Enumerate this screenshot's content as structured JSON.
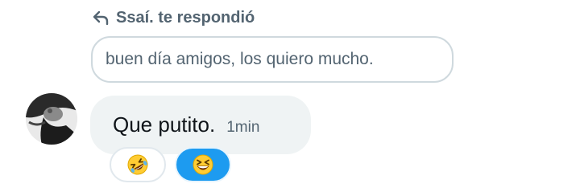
{
  "reply_header": {
    "icon": "reply-arrow-icon",
    "label": "Ssaí. te respondió"
  },
  "quoted_message": {
    "text": "buen día amigos, los quiero mucho."
  },
  "message": {
    "avatar": "user-avatar",
    "text": "Que putito.",
    "time": "1min"
  },
  "reactions": [
    {
      "emoji": "rolling-on-floor-laughing",
      "selected": false
    },
    {
      "emoji": "grinning-squinting-face",
      "selected": true
    }
  ],
  "colors": {
    "accent": "#1d9bf0",
    "muted_text": "#536471",
    "bubble_bg": "#eff3f4",
    "border": "#cfd9de"
  }
}
